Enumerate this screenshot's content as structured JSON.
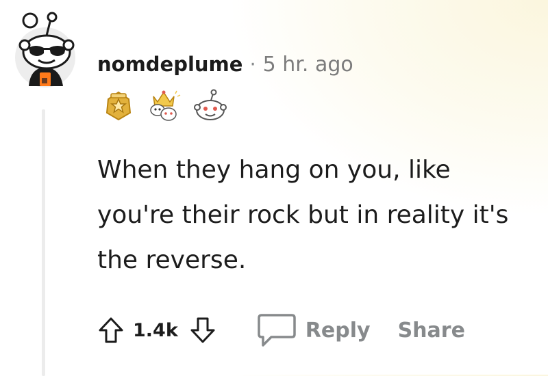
{
  "comment": {
    "author": "nomdeplume",
    "separator": "·",
    "time": "5 hr. ago",
    "text": "When they hang on you, like you're their rock but in reality it's the reverse.",
    "awards": [
      "star-badge-award-icon",
      "crowned-snoo-award-icon",
      "snoo-face-award-icon"
    ]
  },
  "actions": {
    "score": "1.4k",
    "reply_label": "Reply",
    "share_label": "Share"
  },
  "icons": {
    "avatar": "snoo-sunglasses-avatar-icon",
    "upvote": "upvote-arrow-icon",
    "downvote": "downvote-arrow-icon",
    "reply": "speech-bubble-icon"
  },
  "colors": {
    "text": "#1c1c1c",
    "muted": "#878a8c",
    "thread_line": "#ececec",
    "award_gold": "#d9a61f"
  }
}
